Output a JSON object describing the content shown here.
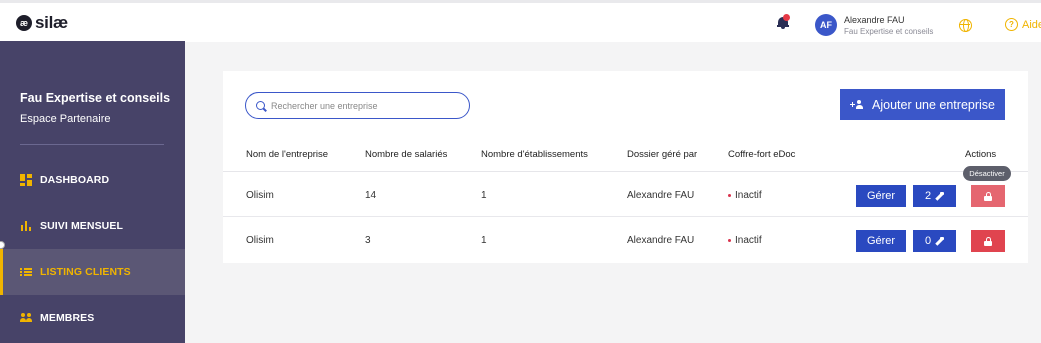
{
  "header": {
    "logo_mark": "æ",
    "logo_text": "silæ",
    "avatar_initials": "AF",
    "user_name": "Alexandre FAU",
    "user_company": "Fau Expertise et conseils",
    "help_label": "Aide",
    "help_glyph": "?",
    "accent_color": "#f0b400"
  },
  "sidebar": {
    "company": "Fau Expertise et conseils",
    "space": "Espace Partenaire",
    "items": [
      {
        "label": "DASHBOARD",
        "icon": "dashboard-grid-icon",
        "active": false
      },
      {
        "label": "SUIVI MENSUEL",
        "icon": "bar-chart-icon",
        "active": false
      },
      {
        "label": "LISTING CLIENTS",
        "icon": "list-icon",
        "active": true
      },
      {
        "label": "MEMBRES",
        "icon": "people-icon",
        "active": false
      }
    ],
    "background_color": "#474368"
  },
  "main": {
    "search_placeholder": "Rechercher une entreprise",
    "add_button_label": "Ajouter une entreprise",
    "primary_color": "#3b57c9",
    "columns": [
      "Nom de l'entreprise",
      "Nombre de salariés",
      "Nombre d'établissements",
      "Dossier géré par",
      "Coffre-fort eDoc",
      "Actions"
    ],
    "rows": [
      {
        "name": "Olisim",
        "employees": "14",
        "establishments": "1",
        "manager": "Alexandre FAU",
        "edoc": "Inactif",
        "manage_label": "Gérer",
        "tools_count": "2"
      },
      {
        "name": "Olisim",
        "employees": "3",
        "establishments": "1",
        "manager": "Alexandre FAU",
        "edoc": "Inactif",
        "manage_label": "Gérer",
        "tools_count": "0"
      }
    ],
    "tooltip": "Désactiver"
  }
}
